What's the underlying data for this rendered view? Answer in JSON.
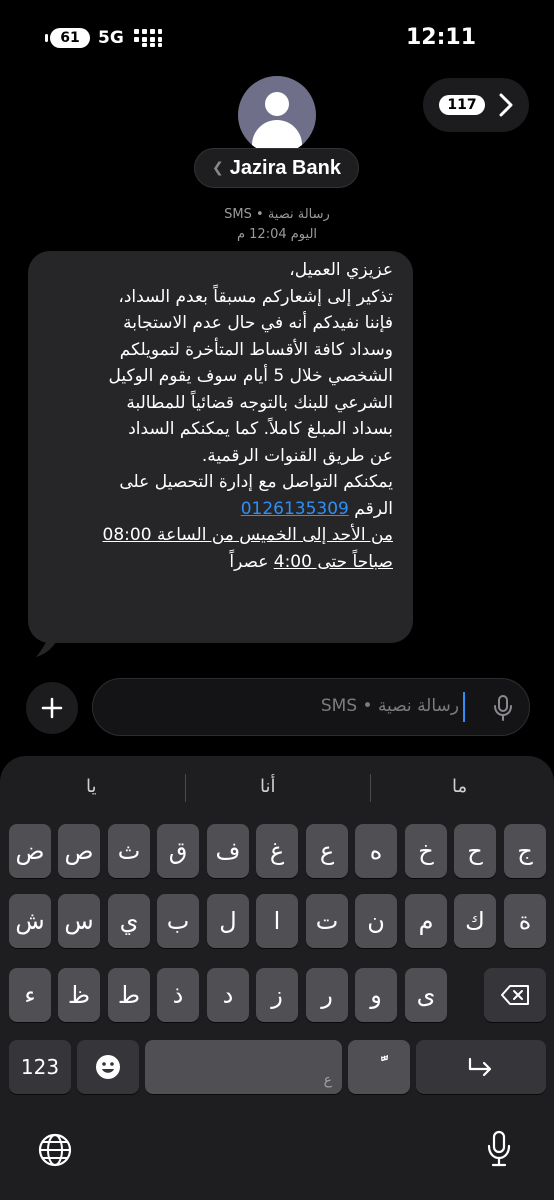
{
  "status_bar": {
    "battery": "61",
    "network": "5G",
    "time": "12:11"
  },
  "header": {
    "contact_name": "Jazira Bank",
    "unread_count": "117",
    "message_type": "رسالة نصية • SMS",
    "timestamp": "اليوم 12:04 م"
  },
  "message": {
    "lines": [
      "عزيزي العميل،",
      "تذكير إلى إشعاركم مسبقاً بعدم السداد،",
      "فإننا نفيدكم أنه في حال عدم الاستجابة",
      "وسداد كافة الأقساط المتأخرة لتمويلكم",
      "الشخصي خلال 5 أيام سوف يقوم الوكيل",
      "الشرعي للبنك بالتوجه قضائياً للمطالبة",
      "بسداد المبلغ كاملاً. كما يمكنكم السداد",
      "عن طريق القنوات الرقمية.",
      "يمكنكم التواصل مع إدارة التحصيل على"
    ],
    "phone_prefix": "الرقم",
    "phone": "0126135309",
    "hours_line1_a": "من الأحد إلى الخميس من الساعة ",
    "hours_time1": "08:00",
    "hours_line2_a": "صباحاً حتى ",
    "hours_time2": "4:00",
    "hours_line2_b": " عصراً"
  },
  "composer": {
    "placeholder": "رسالة نصية • SMS"
  },
  "keyboard": {
    "suggestions": [
      "ما",
      "أنا",
      "يا"
    ],
    "row1": [
      "ج",
      "ح",
      "خ",
      "ه",
      "ع",
      "غ",
      "ف",
      "ق",
      "ث",
      "ص",
      "ض"
    ],
    "row2": [
      "ة",
      "ك",
      "م",
      "ن",
      "ت",
      "ا",
      "ل",
      "ب",
      "ي",
      "س",
      "ش"
    ],
    "row3": [
      "ى",
      "و",
      "ر",
      "ز",
      "د",
      "ذ",
      "ط",
      "ظ",
      "ء"
    ],
    "numbers_key": "123",
    "space_hint": "ع",
    "tanween_key": "ًّ"
  }
}
